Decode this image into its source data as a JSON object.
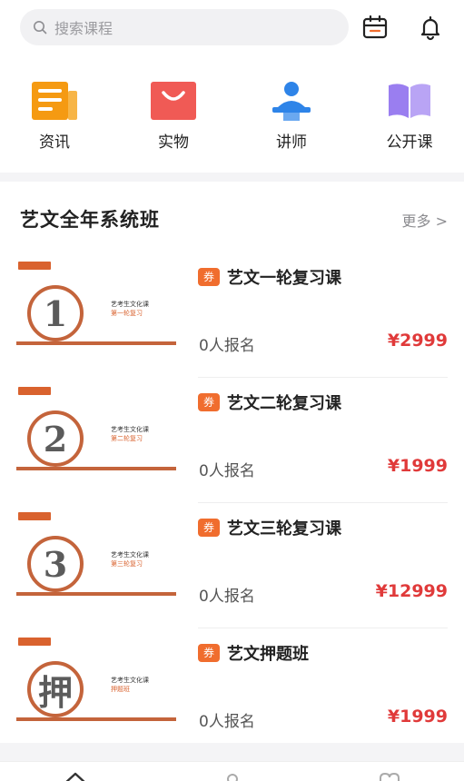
{
  "search": {
    "placeholder": "搜索课程"
  },
  "header_icons": [
    "calendar-icon",
    "bell-icon"
  ],
  "categories": [
    {
      "label": "资讯",
      "icon": "news-icon",
      "color": "#f59a12"
    },
    {
      "label": "实物",
      "icon": "shopping-bag-icon",
      "color": "#f05a55"
    },
    {
      "label": "讲师",
      "icon": "teacher-icon",
      "color": "#2e84e8"
    },
    {
      "label": "公开课",
      "icon": "open-book-icon",
      "color": "#9a7ef0"
    }
  ],
  "section": {
    "title": "艺文全年系统班",
    "more": "更多 >"
  },
  "courses": [
    {
      "coupon": "券",
      "name": "艺文一轮复习课",
      "enroll": "0人报名",
      "price": "¥2999",
      "thumb_num": "1",
      "thumb_title": "艺考生文化课",
      "thumb_sub": "第一轮复习"
    },
    {
      "coupon": "券",
      "name": "艺文二轮复习课",
      "enroll": "0人报名",
      "price": "¥1999",
      "thumb_num": "2",
      "thumb_title": "艺考生文化课",
      "thumb_sub": "第二轮复习"
    },
    {
      "coupon": "券",
      "name": "艺文三轮复习课",
      "enroll": "0人报名",
      "price": "¥12999",
      "thumb_num": "3",
      "thumb_title": "艺考生文化课",
      "thumb_sub": "第三轮复习"
    },
    {
      "coupon": "券",
      "name": "艺文押题班",
      "enroll": "0人报名",
      "price": "¥1999",
      "thumb_num": "押",
      "thumb_title": "艺考生文化课",
      "thumb_sub": "押题班"
    }
  ],
  "bottom_nav": [
    "home-icon",
    "user-icon",
    "heart-icon"
  ],
  "colors": {
    "accent": "#f06d2e",
    "price": "#e03a3a",
    "thumb_orange": "#c4643b"
  }
}
